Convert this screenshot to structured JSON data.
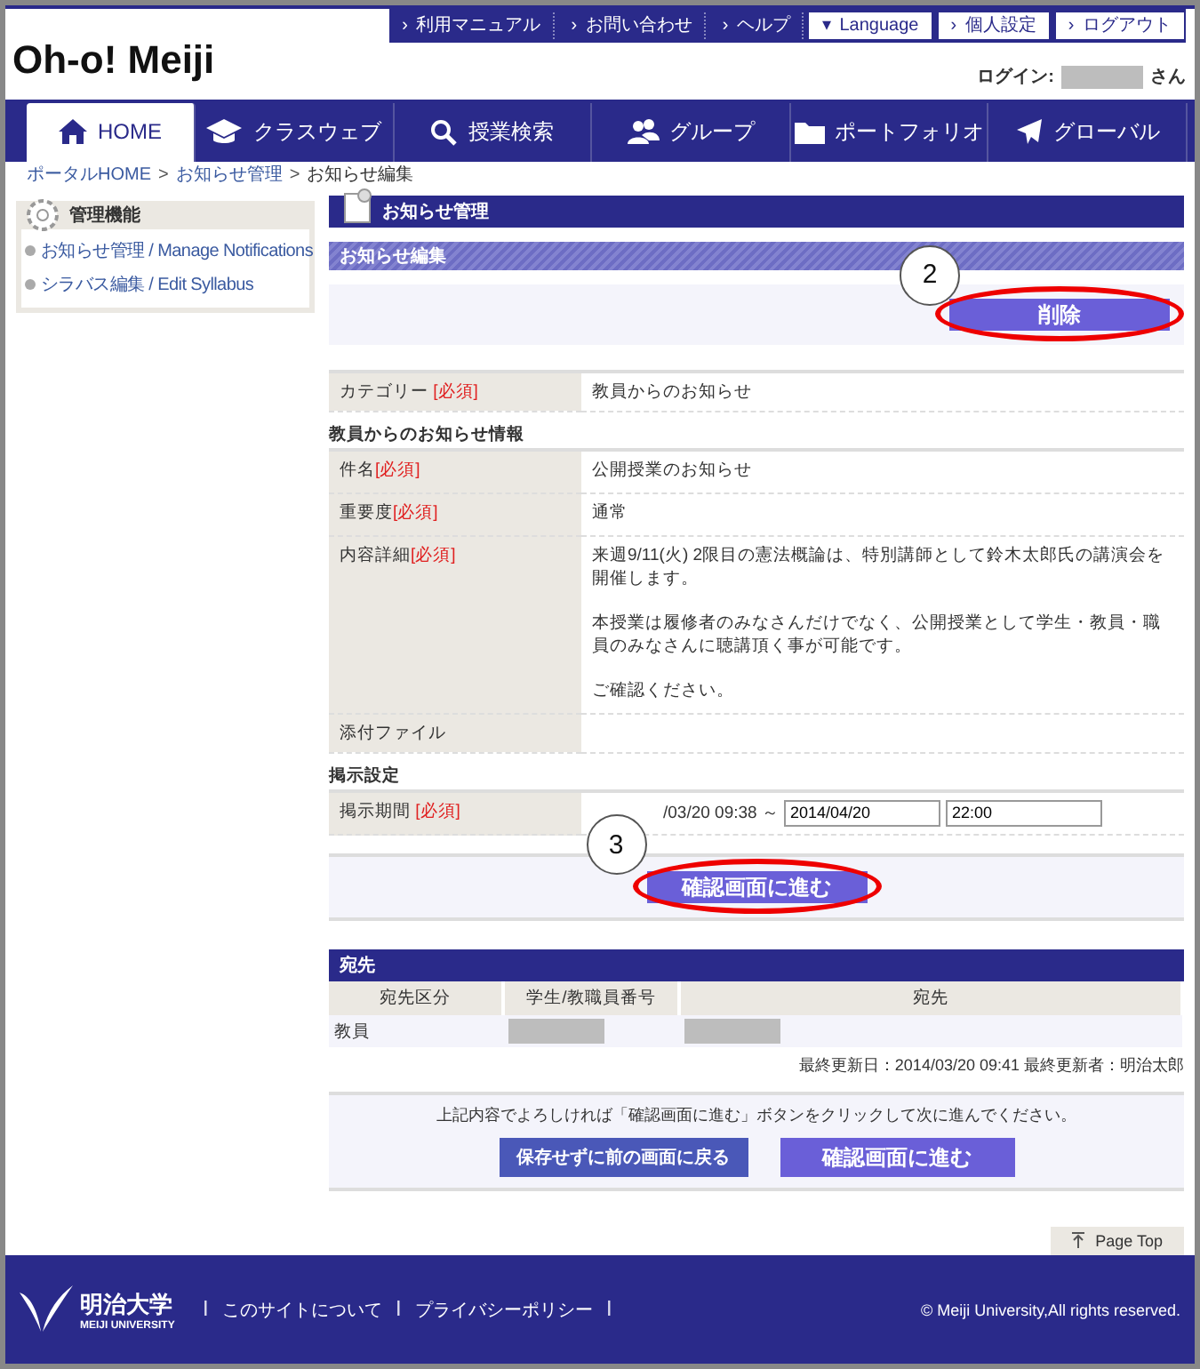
{
  "header": {
    "logo": "Oh-o! Meiji",
    "top_links": [
      {
        "bullet": "›",
        "label": "利用マニュアル",
        "kind": "dark"
      },
      {
        "bullet": "›",
        "label": "お問い合わせ",
        "kind": "dark"
      },
      {
        "bullet": "›",
        "label": "ヘルプ",
        "kind": "dark"
      },
      {
        "bullet": "▾",
        "label": "Language",
        "kind": "light"
      },
      {
        "bullet": "›",
        "label": "個人設定",
        "kind": "light"
      },
      {
        "bullet": "›",
        "label": "ログアウト",
        "kind": "light"
      }
    ],
    "login_label": "ログイン:",
    "login_suffix": "さん"
  },
  "nav_tabs": [
    {
      "label": "HOME",
      "selected": true
    },
    {
      "label": "クラスウェブ",
      "selected": false
    },
    {
      "label": "授業検索",
      "selected": false
    },
    {
      "label": "グループ",
      "selected": false
    },
    {
      "label": "ポートフォリオ",
      "selected": false
    },
    {
      "label": "グローバル",
      "selected": false
    }
  ],
  "breadcrumb": [
    {
      "label": "ポータルHOME",
      "kind": "link"
    },
    {
      "label": ">",
      "kind": "separator"
    },
    {
      "label": "お知らせ管理",
      "kind": "link"
    },
    {
      "label": ">",
      "kind": "separator"
    },
    {
      "label": "お知らせ編集",
      "kind": "current"
    }
  ],
  "sidebar": {
    "title": "管理機能",
    "items": [
      "お知らせ管理 / Manage Notifications",
      "シラバス編集 / Edit Syllabus"
    ]
  },
  "page_title": "お知らせ管理",
  "section_title": "お知らせ編集",
  "delete_button": "削除",
  "category": {
    "label": "カテゴリー",
    "required": "[必須]",
    "value": "教員からのお知らせ"
  },
  "info_heading": "教員からのお知らせ情報",
  "info_rows": [
    {
      "label": "件名",
      "required": "[必須]",
      "lines": [
        "公開授業のお知らせ"
      ]
    },
    {
      "label": "重要度",
      "required": "[必須]",
      "lines": [
        "通常"
      ]
    },
    {
      "label": "内容詳細",
      "required": "[必須]",
      "lines": [
        "来週9/11(火) 2限目の憲法概論は、特別講師として鈴木太郎氏の講演会を開催します。",
        "本授業は履修者のみなさんだけでなく、公開授業として学生・教員・職員のみなさんに聴講頂く事が可能です。",
        "ご確認ください。"
      ]
    },
    {
      "label": "添付ファイル",
      "lines": []
    }
  ],
  "display_heading": "掲示設定",
  "period": {
    "label": "掲示期間",
    "required": "[必須]",
    "start": "/03/20 09:38 ～",
    "end_date": "2014/04/20",
    "end_time": "22:00"
  },
  "confirm_button": "確認画面に進む",
  "recipients": {
    "title": "宛先",
    "columns": [
      "宛先区分",
      "学生/教職員番号",
      "宛先"
    ],
    "rows": [
      {
        "category": "教員"
      }
    ]
  },
  "last_updated": "最終更新日：2014/03/20 09:41  最終更新者：明治太郎",
  "notice": "上記内容でよろしければ「確認画面に進む」ボタンをクリックして次に進んでください。",
  "back_button": "保存せずに前の画面に戻る",
  "confirm_button_2": "確認画面に進む",
  "page_top": "Page Top",
  "footer": {
    "logo_ja": "明治大学",
    "logo_en": "MEIJI UNIVERSITY",
    "links": [
      {
        "label": "|",
        "kind": "separator"
      },
      {
        "label": "このサイトについて",
        "kind": "link"
      },
      {
        "label": "|",
        "kind": "separator"
      },
      {
        "label": "プライバシーポリシー",
        "kind": "link"
      },
      {
        "label": "|",
        "kind": "separator"
      }
    ],
    "copyright": "© Meiji University,All rights reserved."
  },
  "annotations": [
    "2",
    "3"
  ]
}
